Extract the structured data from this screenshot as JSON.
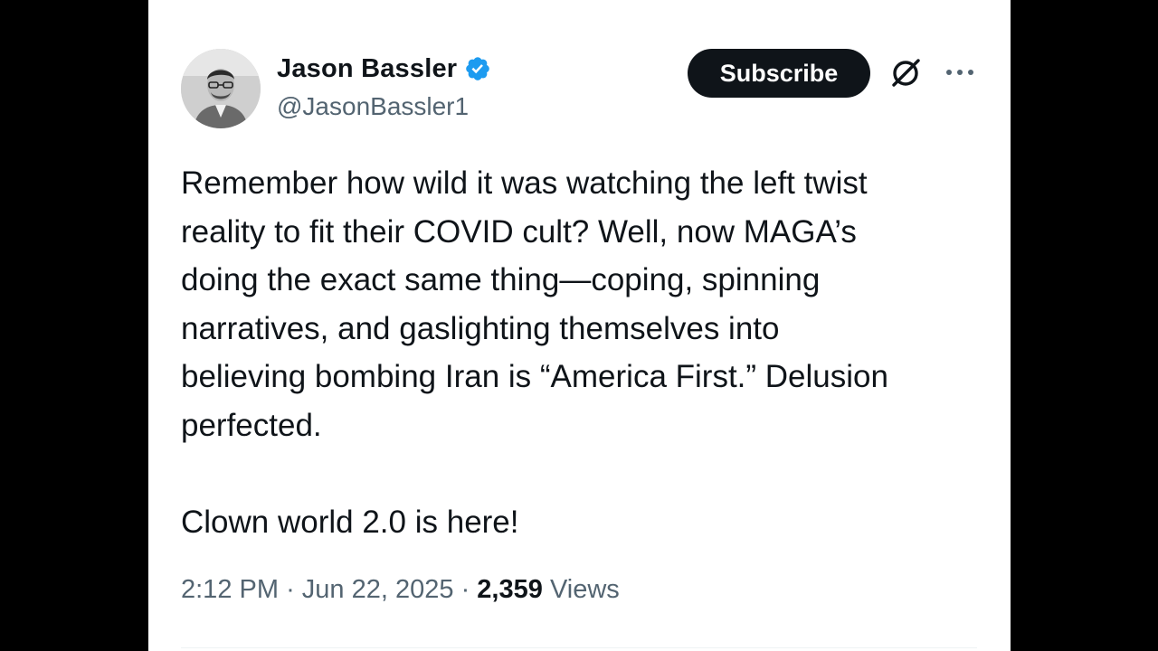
{
  "tweet": {
    "author": {
      "display_name": "Jason Bassler",
      "handle": "@JasonBassler1",
      "verified": true,
      "verified_icon": "verified-badge-icon",
      "verified_color": "#1d9bf0"
    },
    "actions": {
      "subscribe_label": "Subscribe",
      "grok_icon": "grok-icon",
      "more_icon": "more-options-icon"
    },
    "text_lines": [
      "Remember how wild it was watching the left twist",
      "reality to fit their COVID cult? Well, now MAGA’s",
      "doing the exact same thing—coping, spinning",
      "narratives, and gaslighting themselves into",
      "believing bombing Iran is “America First.” Delusion",
      "perfected."
    ],
    "closing_line": "Clown world 2.0 is here!",
    "time": "2:12 PM",
    "separator": "·",
    "date": "Jun 22, 2025",
    "views_count": "2,359",
    "views_label": "Views"
  },
  "colors": {
    "background": "#000000",
    "card": "#ffffff",
    "text": "#0f1419",
    "secondary_text": "#536471",
    "button": "#0f1419"
  }
}
